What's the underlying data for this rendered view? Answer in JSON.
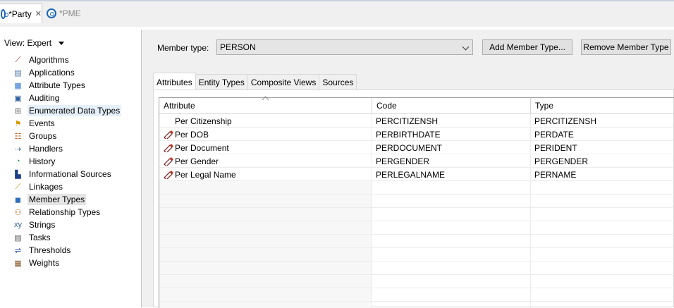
{
  "editor_tabs": [
    {
      "label": "*Party",
      "active": true
    },
    {
      "label": "*PME",
      "active": false
    }
  ],
  "left": {
    "view_label": "View: Expert",
    "items": [
      {
        "label": "Algorithms",
        "icon": "algorithm-icon",
        "glyph": "⟋",
        "color": "#8b1f1f"
      },
      {
        "label": "Applications",
        "icon": "application-icon",
        "glyph": "▤",
        "color": "#4a6fa5"
      },
      {
        "label": "Attribute Types",
        "icon": "attribute-types-icon",
        "glyph": "▦",
        "color": "#3a7bd5"
      },
      {
        "label": "Auditing",
        "icon": "auditing-icon",
        "glyph": "▣",
        "color": "#2f5f9e"
      },
      {
        "label": "Enumerated Data Types",
        "icon": "enum-icon",
        "glyph": "⊞",
        "color": "#555555"
      },
      {
        "label": "Events",
        "icon": "events-icon",
        "glyph": "⚑",
        "color": "#d49a00"
      },
      {
        "label": "Groups",
        "icon": "groups-icon",
        "glyph": "☷",
        "color": "#b5651d"
      },
      {
        "label": "Handlers",
        "icon": "handlers-icon",
        "glyph": "⇢",
        "color": "#2f5f9e"
      },
      {
        "label": "History",
        "icon": "history-icon",
        "glyph": "◔",
        "color": "#2e8b57"
      },
      {
        "label": "Informational Sources",
        "icon": "info-sources-icon",
        "glyph": "▙",
        "color": "#1d3f8a"
      },
      {
        "label": "Linkages",
        "icon": "linkages-icon",
        "glyph": "⟋",
        "color": "#b58b00"
      },
      {
        "label": "Member Types",
        "icon": "member-types-icon",
        "glyph": "◼",
        "color": "#2f6fb8"
      },
      {
        "label": "Relationship Types",
        "icon": "relationship-types-icon",
        "glyph": "⚇",
        "color": "#b5651d"
      },
      {
        "label": "Strings",
        "icon": "strings-icon",
        "glyph": "xy",
        "color": "#2f5f9e"
      },
      {
        "label": "Tasks",
        "icon": "tasks-icon",
        "glyph": "▤",
        "color": "#555555"
      },
      {
        "label": "Thresholds",
        "icon": "thresholds-icon",
        "glyph": "⇌",
        "color": "#2f5f9e"
      },
      {
        "label": "Weights",
        "icon": "weights-icon",
        "glyph": "▦",
        "color": "#8b5a2b"
      }
    ]
  },
  "main": {
    "member_type_label": "Member type:",
    "member_type_value": "PERSON",
    "add_button": "Add Member Type...",
    "remove_button": "Remove Member Type",
    "tabs": [
      "Attributes",
      "Entity Types",
      "Composite Views",
      "Sources"
    ],
    "table": {
      "columns": [
        "Attribute",
        "Code",
        "Type"
      ],
      "rows": [
        {
          "attribute": "Per Citizenship",
          "code": "PERCITIZENSH",
          "type": "PERCITIZENSH",
          "icon": false
        },
        {
          "attribute": "Per DOB",
          "code": "PERBIRTHDATE",
          "type": "PERDATE",
          "icon": true
        },
        {
          "attribute": "Per Document",
          "code": "PERDOCUMENT",
          "type": "PERIDENT",
          "icon": true
        },
        {
          "attribute": "Per Gender",
          "code": "PERGENDER",
          "type": "PERGENDER",
          "icon": true
        },
        {
          "attribute": "Per Legal Name",
          "code": "PERLEGALNAME",
          "type": "PERNAME",
          "icon": true
        }
      ]
    }
  }
}
